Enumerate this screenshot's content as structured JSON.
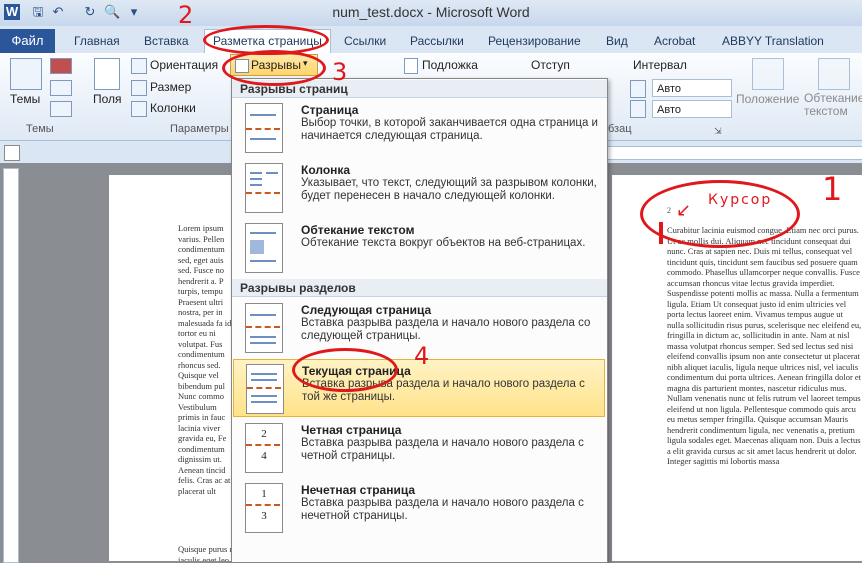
{
  "window": {
    "title": "num_test.docx - Microsoft Word"
  },
  "tabs": [
    "Файл",
    "Главная",
    "Вставка",
    "Разметка страницы",
    "Ссылки",
    "Рассылки",
    "Рецензирование",
    "Вид",
    "Acrobat",
    "ABBYY Translation"
  ],
  "ribbon": {
    "themes_label": "Темы",
    "themes_group": "Темы",
    "margins_label": "Поля",
    "orientation_label": "Ориентация",
    "size_label": "Размер",
    "columns_label": "Колонки",
    "breaks_label": "Разрывы",
    "page_setup_group": "Параметры",
    "watermark_label": "Подложка",
    "indent_label": "Отступ",
    "spacing_label": "Интервал",
    "spacing_before": "Авто",
    "spacing_after": "Авто",
    "paragraph_group": "бзац",
    "position_label": "Положение",
    "wrap_label": "Обтекание текстом"
  },
  "menu": {
    "page_breaks_header": "Разрывы страниц",
    "section_breaks_header": "Разрывы разделов",
    "items": [
      {
        "title": "Страница",
        "desc": "Выбор точки, в которой заканчивается одна страница и начинается следующая страница."
      },
      {
        "title": "Колонка",
        "desc": "Указывает, что текст, следующий за разрывом колонки, будет перенесен в начало следующей колонки."
      },
      {
        "title": "Обтекание текстом",
        "desc": "Обтекание текста вокруг объектов на веб-страницах."
      },
      {
        "title": "Следующая страница",
        "desc": "Вставка разрыва раздела и начало нового раздела со следующей страницы."
      },
      {
        "title": "Текущая страница",
        "desc": "Вставка разрыва раздела и начало нового раздела с той же страницы."
      },
      {
        "title": "Четная страница",
        "desc": "Вставка разрыва раздела и начало нового раздела с четной страницы."
      },
      {
        "title": "Нечетная страница",
        "desc": "Вставка разрыва раздела и начало нового раздела с нечетной страницы."
      }
    ]
  },
  "annotations": {
    "n1": "1",
    "n2": "2",
    "n3": "3",
    "n4": "4",
    "cursor": "Курсор",
    "page_number": "2"
  },
  "left_page_text": "Lorem ipsum varius. Pellen condimentum sed, eget auis sed. Fusce no hendrerit a. P turpis, tempu Praesent ultri nostra, per in malesuada fa id tortor eu ni volutpat. Fus condimentum rhoncus sed. Quisque vel bibendum pul Nunc commo Vestibulum primis in fauc lacinia viver gravida eu, Fe condimentum dignissim ut. Aenean tincid felis. Cras ac at placerat ult",
  "left_page_bottom": "Quisque purus mauris, gravida non placerat eu, congue vitae lacus. Suspendisse lorem ante, fermentum vel eleifend a, iaculis eget leo.",
  "right_page_text": "Curabitur lacinia euismod congue. Etiam nec orci purus. Ut ac mollis dui. Aliquam nec tincidunt consequat dui nunc. Cras at sapien nec. Duis mi tellus, consequat vel tincidunt quis, tincidunt sem faucibus sed posuere quam commodo. Phasellus ullamcorper neque convallis. Fusce accumsan rhoncus vitae lectus gravida imperdiet. Suspendisse potenti mollis ac massa. Nulla a fermentum ligula. Etiam Ut consequat justo id enim ultricies vel porta lectus laoreet enim. Vivamus tempus augue ut nulla sollicitudin risus purus, scelerisque nec eleifend eu, fringilla in dictum ac, sollicitudin in ante. Nam at nisl massa volutpat rhoncus semper. Sed sed lectus sed nisi eleifend convallis ipsum non ante consectetur ut placerat nibh aliquet iaculis, ligula neque ultrices nisl, vel iaculis condimentum dui porta ultrices. Aenean fringilla dolor et magna dis parturient montes, nascetur ridiculus mus. Nullam venenatis nunc ut felis rutrum vel laoreet tempus eleifend ut non ligula. Pellentesque commodo quis arcu eu metus semper fringilla. Quisque accumsan Mauris hendrerit condimentum ligula, nec venenatis a, pretium ligula sodales eget. Maecenas aliquam non. Duis a lectus a elit gravida cursus ac sit amet lacus hendrerit ut dolor. Integer sagittis mi lobortis massa"
}
